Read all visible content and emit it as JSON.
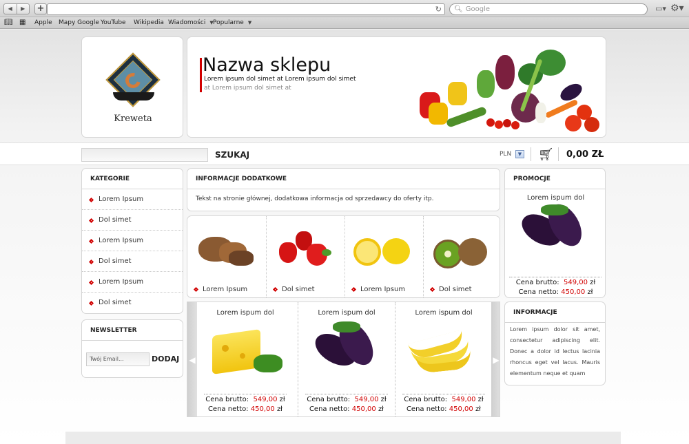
{
  "browser": {
    "search_placeholder": "Google",
    "bookmarks": [
      "Apple",
      "Mapy Google",
      "YouTube",
      "Wikipedia",
      "Wiadomości",
      "Popularne"
    ]
  },
  "shop": {
    "logo_text": "Kreweta",
    "name": "Nazwa sklepu",
    "tagline_1": "Lorem ipsum dol simet at Lorem ipsum dol simet",
    "tagline_2": "at Lorem ipsum dol simet at"
  },
  "search": {
    "button": "SZUKAJ"
  },
  "currency": "PLN",
  "cart": {
    "total": "0,00 ZŁ"
  },
  "categories": {
    "title": "KATEGORIE",
    "items": [
      "Lorem Ipsum",
      "Dol simet",
      "Lorem Ipsum",
      "Dol simet",
      "Lorem Ipsum",
      "Dol simet"
    ]
  },
  "newsletter": {
    "title": "NEWSLETTER",
    "placeholder": "Twój Email...",
    "button": "DODAJ"
  },
  "info": {
    "title": "INFORMACJE DODATKOWE",
    "text": "Tekst na stronie głównej, dodatkowa informacja od sprzedawcy do oferty itp."
  },
  "product_categories": [
    "Lorem Ipsum",
    "Dol simet",
    "Lorem Ipsum",
    "Dol simet"
  ],
  "carousel": [
    {
      "title": "Lorem ispum dol",
      "gross_label": "Cena brutto:",
      "gross": "549,00",
      "net_label": "Cena netto:",
      "net": "450,00",
      "unit": "zł"
    },
    {
      "title": "Lorem ispum dol",
      "gross_label": "Cena brutto:",
      "gross": "549,00",
      "net_label": "Cena netto:",
      "net": "450,00",
      "unit": "zł"
    },
    {
      "title": "Lorem ispum dol",
      "gross_label": "Cena brutto:",
      "gross": "549,00",
      "net_label": "Cena netto:",
      "net": "450,00",
      "unit": "zł"
    }
  ],
  "promo": {
    "title": "PROMOCJE",
    "product": "Lorem ispum dol",
    "gross_label": "Cena brutto:",
    "gross": "549,00",
    "net_label": "Cena netto:",
    "net": "450,00",
    "unit": "zł"
  },
  "informacje": {
    "title": "INFORMACJE",
    "text": "Lorem ipsum dolor sit amet, consectetur adipiscing elit. Donec a dolor id lectus lacinia rhoncus eget vel lacus. Mauris elementum neque et quam"
  },
  "colors": {
    "accent": "#d10000"
  }
}
